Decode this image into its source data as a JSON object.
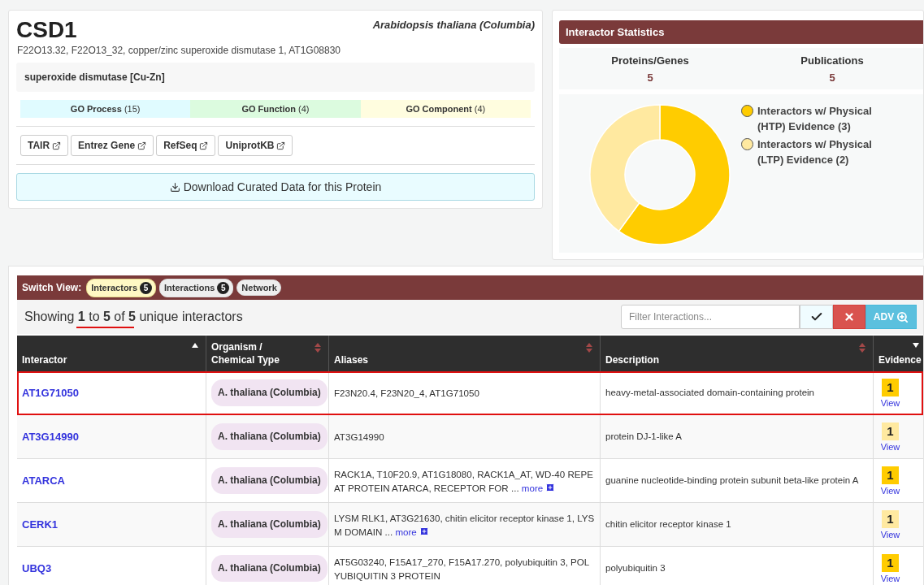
{
  "protein": {
    "name": "CSD1",
    "species": "Arabidopsis thaliana (Columbia)",
    "aliases": "F22O13.32, F22O13_32, copper/zinc superoxide dismutase 1, AT1G08830",
    "description": "superoxide dismutase [Cu-Zn]",
    "go": [
      {
        "kind": "process",
        "label": "GO Process",
        "count": "(15)"
      },
      {
        "kind": "function",
        "label": "GO Function",
        "count": "(4)"
      },
      {
        "kind": "component",
        "label": "GO Component",
        "count": "(4)"
      }
    ],
    "links": [
      "TAIR",
      "Entrez Gene",
      "RefSeq",
      "UniprotKB"
    ],
    "download": "Download Curated Data for this Protein"
  },
  "stats": {
    "title": "Interactor Statistics",
    "counts": [
      {
        "label": "Proteins/Genes",
        "value": "5"
      },
      {
        "label": "Publications",
        "value": "5"
      }
    ],
    "chart_data": {
      "type": "donut",
      "categories": [
        "Interactors w/ Physical (HTP) Evidence (3)",
        "Interactors w/ Physical (LTP) Evidence (2)"
      ],
      "values": [
        3,
        2
      ],
      "colors": [
        "#ffcc00",
        "#ffe9a0"
      ]
    }
  },
  "switch_view": {
    "label": "Switch View:",
    "options": [
      {
        "label": "Interactors",
        "count": "5",
        "selected": true
      },
      {
        "label": "Interactions",
        "count": "5",
        "selected": false
      },
      {
        "label": "Network",
        "selected": false
      }
    ]
  },
  "showing": {
    "text": "Showing **1** to **5** of **5** unique interactors",
    "underlined": true
  },
  "filter": {
    "placeholder": "Filter Interactions...",
    "adv": "ADV"
  },
  "table": {
    "columns": [
      {
        "label": "Interactor",
        "kind": "ascending"
      },
      {
        "label": "Organism / Chemical Type",
        "kind": "sortable"
      },
      {
        "label": "Aliases",
        "kind": "sortable"
      },
      {
        "label": "Description",
        "kind": "sortable"
      },
      {
        "label": "Evidence",
        "kind": "descending"
      }
    ],
    "rows": [
      {
        "interactor": "AT1G71050",
        "organism": "A. thaliana (Columbia)",
        "aliases": "F23N20.4, F23N20_4, AT1G71050",
        "description": "heavy-metal-associated domain-containing protein",
        "evidence": "1",
        "view": "View",
        "color": "#ffcc00",
        "highlighted": true
      },
      {
        "interactor": "AT3G14990",
        "organism": "A. thaliana (Columbia)",
        "aliases": "AT3G14990",
        "description": "protein DJ-1-like A",
        "evidence": "1",
        "view": "View",
        "color": "#ffe9a0",
        "highlighted": false
      },
      {
        "interactor": "ATARCA",
        "organism": "A. thaliana (Columbia)",
        "aliases": "RACK1A, T10F20.9, AT1G18080, RACK1A_AT, WD-40 REPEAT PROTEIN ATARCA, RECEPTOR FOR ...",
        "more": "more",
        "description": "guanine nucleotide-binding protein subunit beta-like protein A",
        "evidence": "1",
        "view": "View",
        "color": "#ffcc00",
        "highlighted": false
      },
      {
        "interactor": "CERK1",
        "organism": "A. thaliana (Columbia)",
        "aliases": "LYSM RLK1, AT3G21630, chitin elicitor receptor kinase 1, LYSM DOMAIN ...",
        "more": "more",
        "description": "chitin elicitor receptor kinase 1",
        "evidence": "1",
        "view": "View",
        "color": "#ffe9a0",
        "highlighted": false
      },
      {
        "interactor": "UBQ3",
        "organism": "A. thaliana (Columbia)",
        "aliases": "AT5G03240, F15A17_270, F15A17.270, polyubiquitin 3, POLYUBIQUITIN 3 PROTEIN",
        "description": "polyubiquitin 3",
        "evidence": "1",
        "view": "View",
        "color": "#ffcc00",
        "highlighted": false
      }
    ]
  }
}
